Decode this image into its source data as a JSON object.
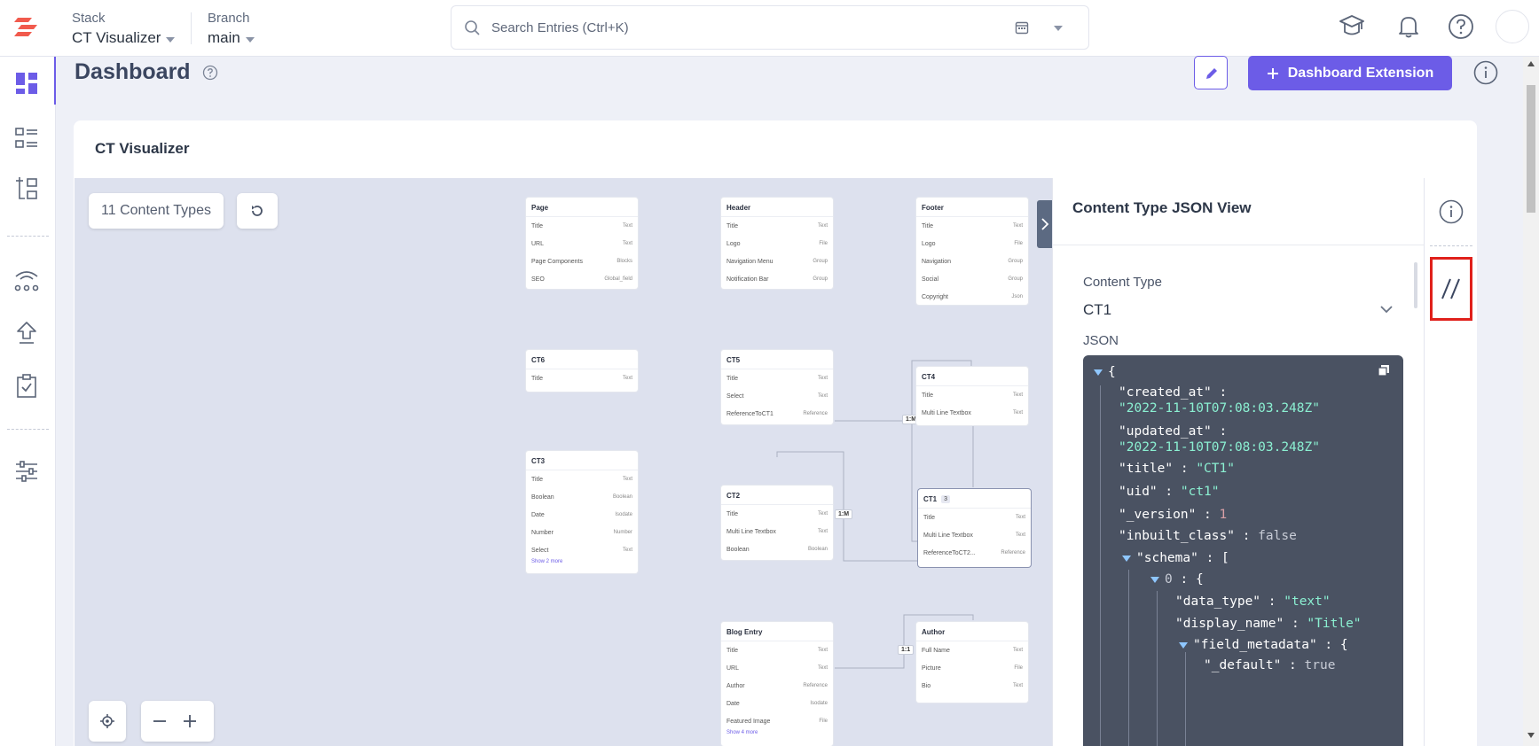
{
  "header": {
    "stack_label": "Stack",
    "stack_value": "CT Visualizer",
    "branch_label": "Branch",
    "branch_value": "main",
    "search_placeholder": "Search Entries (Ctrl+K)"
  },
  "page": {
    "title": "Dashboard",
    "extension_button": "Dashboard Extension"
  },
  "card": {
    "title": "CT Visualizer",
    "count_label": "11 Content Types"
  },
  "nodes": {
    "page": {
      "title": "Page",
      "fields": [
        [
          "Title",
          "Text"
        ],
        [
          "URL",
          "Text"
        ],
        [
          "Page Components",
          "Blocks"
        ],
        [
          "SEO",
          "Global_field"
        ]
      ]
    },
    "header": {
      "title": "Header",
      "fields": [
        [
          "Title",
          "Text"
        ],
        [
          "Logo",
          "File"
        ],
        [
          "Navigation Menu",
          "Group"
        ],
        [
          "Notification Bar",
          "Group"
        ]
      ]
    },
    "footer": {
      "title": "Footer",
      "fields": [
        [
          "Title",
          "Text"
        ],
        [
          "Logo",
          "File"
        ],
        [
          "Navigation",
          "Group"
        ],
        [
          "Social",
          "Group"
        ],
        [
          "Copyright",
          "Json"
        ]
      ]
    },
    "ct6": {
      "title": "CT6",
      "fields": [
        [
          "Title",
          "Text"
        ]
      ]
    },
    "ct5": {
      "title": "CT5",
      "fields": [
        [
          "Title",
          "Text"
        ],
        [
          "Select",
          "Text"
        ],
        [
          "ReferenceToCT1",
          "Reference"
        ]
      ]
    },
    "ct4": {
      "title": "CT4",
      "fields": [
        [
          "Title",
          "Text"
        ],
        [
          "Multi Line Textbox",
          "Text"
        ]
      ]
    },
    "ct3": {
      "title": "CT3",
      "fields": [
        [
          "Title",
          "Text"
        ],
        [
          "Boolean",
          "Boolean"
        ],
        [
          "Date",
          "Isodate"
        ],
        [
          "Number",
          "Number"
        ],
        [
          "Select",
          "Text"
        ]
      ],
      "more": "Show 2 more"
    },
    "ct2": {
      "title": "CT2",
      "fields": [
        [
          "Title",
          "Text"
        ],
        [
          "Multi Line Textbox",
          "Text"
        ],
        [
          "Boolean",
          "Boolean"
        ]
      ]
    },
    "ct1": {
      "title": "CT1",
      "badge": "3",
      "fields": [
        [
          "Title",
          "Text"
        ],
        [
          "Multi Line Textbox",
          "Text"
        ],
        [
          "ReferenceToCT2...",
          "Reference"
        ]
      ]
    },
    "blog": {
      "title": "Blog Entry",
      "fields": [
        [
          "Title",
          "Text"
        ],
        [
          "URL",
          "Text"
        ],
        [
          "Author",
          "Reference"
        ],
        [
          "Date",
          "Isodate"
        ],
        [
          "Featured Image",
          "File"
        ]
      ],
      "more": "Show 4 more"
    },
    "author": {
      "title": "Author",
      "fields": [
        [
          "Full Name",
          "Text"
        ],
        [
          "Picture",
          "File"
        ],
        [
          "Bio",
          "Text"
        ]
      ]
    }
  },
  "edges": [
    "1:M",
    "1:M",
    "1:1"
  ],
  "json_panel": {
    "title": "Content Type JSON View",
    "ct_label": "Content Type",
    "ct_value": "CT1",
    "json_label": "JSON",
    "lines": {
      "open": "{",
      "created_key": "\"created_at\"",
      "created_val": "\"2022-11-10T07:08:03.248Z\"",
      "updated_key": "\"updated_at\"",
      "updated_val": "\"2022-11-10T07:08:03.248Z\"",
      "title_key": "\"title\"",
      "title_val": "\"CT1\"",
      "uid_key": "\"uid\"",
      "uid_val": "\"ct1\"",
      "version_key": "\"_version\"",
      "version_val": "1",
      "inbuilt_key": "\"inbuilt_class\"",
      "inbuilt_val": "false",
      "schema_key": "\"schema\"",
      "schema_open": "[",
      "zero_key": "0",
      "zero_open": "{",
      "dt_key": "\"data_type\"",
      "dt_val": "\"text\"",
      "dn_key": "\"display_name\"",
      "dn_val": "\"Title\"",
      "fm_key": "\"field_metadata\"",
      "fm_open": "{",
      "def_key": "\"_default\"",
      "def_val": "true",
      "colon": ":"
    }
  }
}
